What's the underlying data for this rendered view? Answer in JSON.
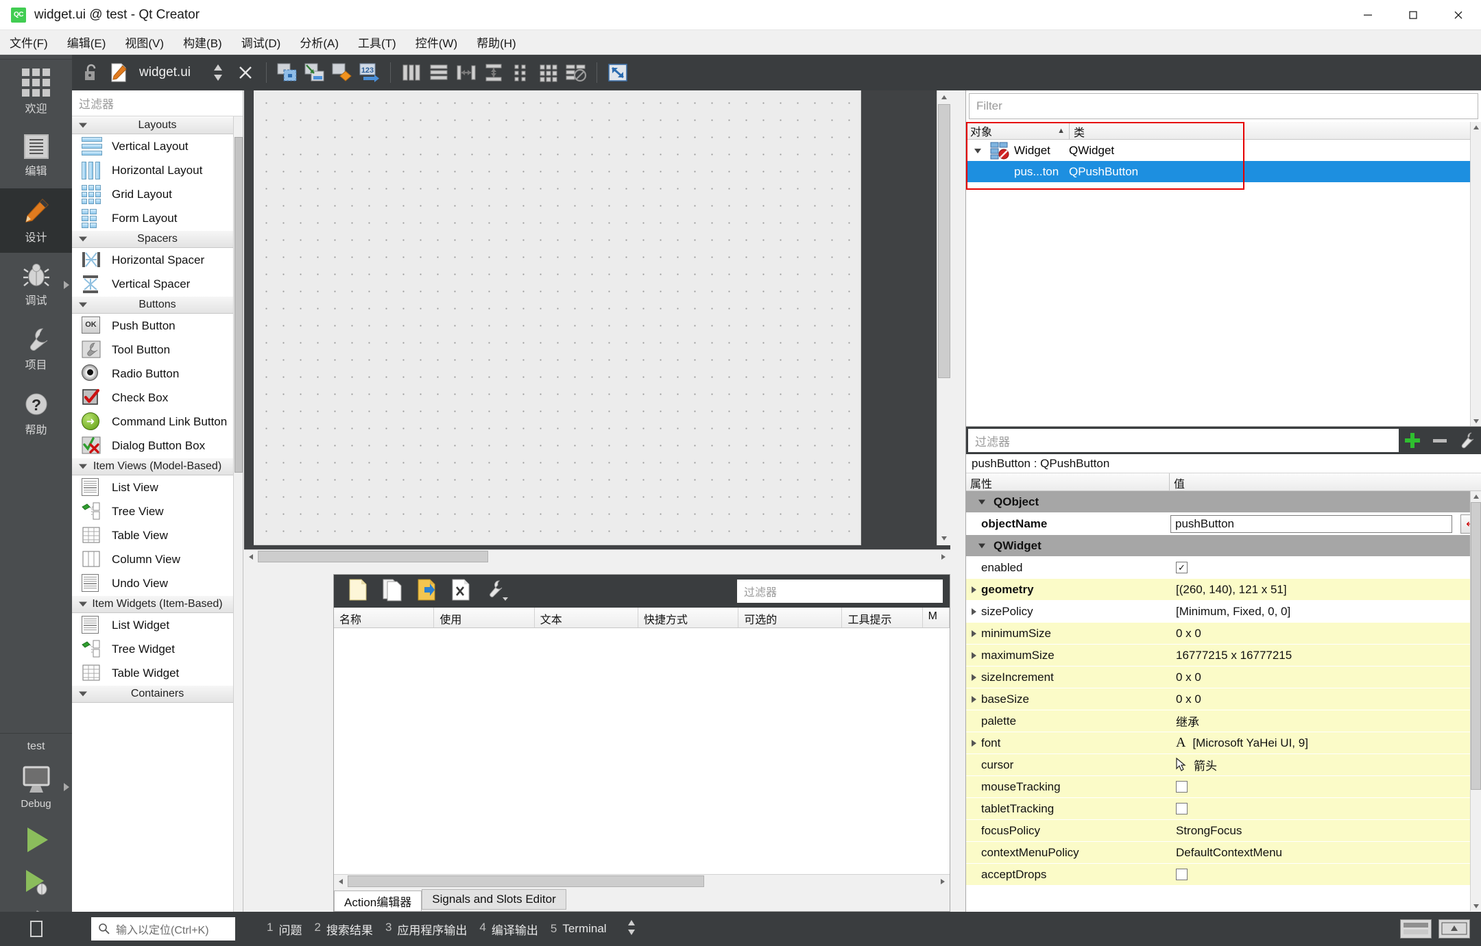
{
  "window": {
    "title": "widget.ui @ test - Qt Creator",
    "logo_text": "QC",
    "minimize": "─",
    "maximize": "□",
    "close": "✕"
  },
  "menubar": {
    "items": [
      {
        "label": "文件(F)"
      },
      {
        "label": "编辑(E)"
      },
      {
        "label": "视图(V)"
      },
      {
        "label": "构建(B)"
      },
      {
        "label": "调试(D)"
      },
      {
        "label": "分析(A)"
      },
      {
        "label": "工具(T)"
      },
      {
        "label": "控件(W)"
      },
      {
        "label": "帮助(H)"
      }
    ]
  },
  "modebar": {
    "items": [
      {
        "label": "欢迎",
        "icon": "grid-icon",
        "active": false
      },
      {
        "label": "编辑",
        "icon": "document-lines-icon",
        "active": false
      },
      {
        "label": "设计",
        "icon": "pencil-icon",
        "active": true
      },
      {
        "label": "调试",
        "icon": "bug-icon",
        "active": false,
        "arrow": true
      },
      {
        "label": "项目",
        "icon": "wrench-icon",
        "active": false
      },
      {
        "label": "帮助",
        "icon": "question-mark-icon",
        "active": false
      }
    ],
    "kit_name": "test",
    "build_config": "Debug"
  },
  "designer_toolbar": {
    "filename": "widget.ui",
    "lock_icon": "lock-open-icon",
    "file_icon": "ui-file-icon",
    "split_icon": "split-updown-icon",
    "close_icon": "close-editor-icon",
    "tools": [
      "edit-widgets-icon",
      "edit-signals-slots-icon",
      "edit-buddies-icon",
      "edit-tab-order-icon",
      "layout-horizontal-icon",
      "layout-vertical-icon",
      "layout-splitter-horizontal-icon",
      "layout-splitter-vertical-icon",
      "layout-form-icon",
      "layout-grid-icon",
      "break-layout-icon",
      "adjust-size-icon"
    ]
  },
  "widgetbox": {
    "filter_placeholder": "过滤器",
    "groups": [
      {
        "title": "Layouts",
        "items": [
          {
            "label": "Vertical Layout",
            "icon": "vertical-layout-icon"
          },
          {
            "label": "Horizontal Layout",
            "icon": "horizontal-layout-icon"
          },
          {
            "label": "Grid Layout",
            "icon": "grid-layout-icon"
          },
          {
            "label": "Form Layout",
            "icon": "form-layout-icon"
          }
        ]
      },
      {
        "title": "Spacers",
        "items": [
          {
            "label": "Horizontal Spacer",
            "icon": "horizontal-spacer-icon"
          },
          {
            "label": "Vertical Spacer",
            "icon": "vertical-spacer-icon"
          }
        ]
      },
      {
        "title": "Buttons",
        "items": [
          {
            "label": "Push Button",
            "icon": "push-button-icon"
          },
          {
            "label": "Tool Button",
            "icon": "tool-button-icon"
          },
          {
            "label": "Radio Button",
            "icon": "radio-button-icon"
          },
          {
            "label": "Check Box",
            "icon": "check-box-icon"
          },
          {
            "label": "Command Link Button",
            "icon": "command-link-button-icon"
          },
          {
            "label": "Dialog Button Box",
            "icon": "dialog-button-box-icon"
          }
        ]
      },
      {
        "title": "Item Views (Model-Based)",
        "items": [
          {
            "label": "List View",
            "icon": "list-view-icon"
          },
          {
            "label": "Tree View",
            "icon": "tree-view-icon"
          },
          {
            "label": "Table View",
            "icon": "table-view-icon"
          },
          {
            "label": "Column View",
            "icon": "column-view-icon"
          },
          {
            "label": "Undo View",
            "icon": "undo-view-icon"
          }
        ]
      },
      {
        "title": "Item Widgets (Item-Based)",
        "items": [
          {
            "label": "List Widget",
            "icon": "list-widget-icon"
          },
          {
            "label": "Tree Widget",
            "icon": "tree-widget-icon"
          },
          {
            "label": "Table Widget",
            "icon": "table-widget-icon"
          }
        ]
      },
      {
        "title": "Containers",
        "items": []
      }
    ]
  },
  "object_inspector": {
    "filter_placeholder": "Filter",
    "columns": [
      "对象",
      "类"
    ],
    "sort_indicator": "▲",
    "rows": [
      {
        "name": "Widget",
        "class": "QWidget",
        "level": 0,
        "expanded": true,
        "selected": false,
        "icon": "qwidget-icon"
      },
      {
        "name": "pus...ton",
        "class": "QPushButton",
        "level": 1,
        "expanded": false,
        "selected": true,
        "icon": "none"
      }
    ]
  },
  "property_editor": {
    "filter_placeholder": "过滤器",
    "add_icon": "plus-icon",
    "remove_icon": "minus-icon",
    "config_icon": "wrench-icon",
    "object_line": "pushButton : QPushButton",
    "columns": [
      "属性",
      "值"
    ],
    "rows": [
      {
        "key": "QObject",
        "value": "",
        "type": "group",
        "expanded": true
      },
      {
        "key": "objectName",
        "value": "pushButton",
        "type": "edit",
        "bold": true,
        "highlight": false,
        "reset_icon": "reset-arrow-icon"
      },
      {
        "key": "QWidget",
        "value": "",
        "type": "group",
        "expanded": true
      },
      {
        "key": "enabled",
        "value": "",
        "type": "checkbox",
        "checked": true,
        "highlight": false
      },
      {
        "key": "geometry",
        "value": "[(260, 140), 121 x 51]",
        "type": "expandable",
        "bold": true,
        "highlight": true
      },
      {
        "key": "sizePolicy",
        "value": "[Minimum, Fixed, 0, 0]",
        "type": "expandable",
        "highlight": false
      },
      {
        "key": "minimumSize",
        "value": "0 x 0",
        "type": "expandable",
        "highlight": true
      },
      {
        "key": "maximumSize",
        "value": "16777215 x 16777215",
        "type": "expandable",
        "highlight": true
      },
      {
        "key": "sizeIncrement",
        "value": "0 x 0",
        "type": "expandable",
        "highlight": true
      },
      {
        "key": "baseSize",
        "value": "0 x 0",
        "type": "expandable",
        "highlight": true
      },
      {
        "key": "palette",
        "value": "继承",
        "type": "text",
        "highlight": true
      },
      {
        "key": "font",
        "value": "[Microsoft YaHei UI, 9]",
        "type": "font",
        "icon": "font-A-icon",
        "highlight": true
      },
      {
        "key": "cursor",
        "value": "箭头",
        "type": "cursor",
        "icon": "arrow-cursor-icon",
        "highlight": true
      },
      {
        "key": "mouseTracking",
        "value": "",
        "type": "checkbox",
        "checked": false,
        "highlight": true
      },
      {
        "key": "tabletTracking",
        "value": "",
        "type": "checkbox",
        "checked": false,
        "highlight": true
      },
      {
        "key": "focusPolicy",
        "value": "StrongFocus",
        "type": "text",
        "highlight": true
      },
      {
        "key": "contextMenuPolicy",
        "value": "DefaultContextMenu",
        "type": "text",
        "highlight": true
      },
      {
        "key": "acceptDrops",
        "value": "",
        "type": "checkbox",
        "checked": false,
        "highlight": true
      }
    ]
  },
  "action_editor": {
    "filter_placeholder": "过滤器",
    "toolbar_icons": [
      "new-action-icon",
      "copy-action-icon",
      "edit-action-icon",
      "delete-action-icon",
      "configure-icon"
    ],
    "columns": [
      "名称",
      "使用",
      "文本",
      "快捷方式",
      "可选的",
      "工具提示",
      "M"
    ],
    "rows": [],
    "tabs": [
      {
        "label": "Action编辑器",
        "active": true
      },
      {
        "label": "Signals and Slots Editor",
        "active": false
      }
    ]
  },
  "statusbar": {
    "locator_placeholder": "输入以定位(Ctrl+K)",
    "search_icon": "magnifier-icon",
    "items": [
      {
        "num": "1",
        "label": "问题"
      },
      {
        "num": "2",
        "label": "搜索结果"
      },
      {
        "num": "3",
        "label": "应用程序输出"
      },
      {
        "num": "4",
        "label": "编译输出"
      },
      {
        "num": "5",
        "label": "Terminal"
      }
    ],
    "updown_icon": "updown-arrows-icon"
  },
  "colors": {
    "accent_orange": "#e07b1f",
    "selection_blue": "#1d8fe0",
    "highlight_red": "#e60000",
    "dark_chrome": "#3a3d3f",
    "mode_bar": "#4a4d4f",
    "property_highlight": "#fbfbc8"
  }
}
